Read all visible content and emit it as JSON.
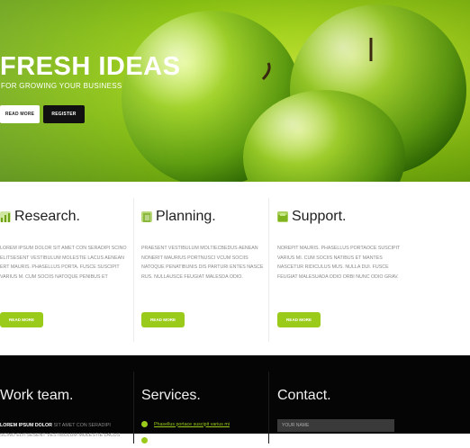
{
  "hero": {
    "title": "FRESH IDEAS",
    "subtitle": "FOR GROWING YOUR BUSINESS",
    "read_more_label": "READ MORE",
    "register_label": "REGISTER"
  },
  "features": [
    {
      "title": "Research.",
      "icon": "chart-icon",
      "text": "LOREM IPSUM DOLOR SIT AMET CON SERADIPI SCINO ELITSESENT VESTIBULUM MOLESTIE LACUS AENEAN ERT MAURIS. PHASELLUS PORTA. FUSCE SUSCIPIT VARIUS M. CUM SOCIIS NATOQUE PENIBUS ET",
      "button_label": "READ MORE"
    },
    {
      "title": "Planning.",
      "icon": "notebook-icon",
      "text": "PRAESENT VESTIBULUM MOLTIECBEDUS AENEAN NONERIT MAURIUS PORTNUSCI VCUM SOCIIS NATOQUE PENATIBUNIS DIS PARTURI ENTES NASCE RUS. NULLAUSCE FEUGIAT MALESDA ODIO.",
      "button_label": "READ MORE"
    },
    {
      "title": "Support.",
      "icon": "support-icon",
      "text": "NOREPIT MAURIS. PHASELLUS PORTAOCE SUSCIPIT VARIUS MI. CUM SOCIIS NATIBUS ET MANTES NASCETUR RIDICULUS MUS. NULLA DUI. FUSCE FEUGIAT MALESUADA ODIO ORBI NUNC ODIO GRAV.",
      "button_label": "READ MORE"
    }
  ],
  "footer": {
    "work_title": "Work team.",
    "work_text_bold": "LOREM IPSUM DOLOR",
    "work_text": " SIT AMET CON SERADIPI SCINO ELITSESENT VESTIBULUM MOLESTIE LACUS",
    "services_title": "Services.",
    "services_items": [
      "Phasellus portace suscipit varius mi",
      ""
    ],
    "contact_title": "Contact.",
    "contact_name_placeholder": "YOUR NAME"
  },
  "colors": {
    "accent": "#9acb1b",
    "hero_green": "#a6d61e",
    "footer_bg": "#050505"
  }
}
